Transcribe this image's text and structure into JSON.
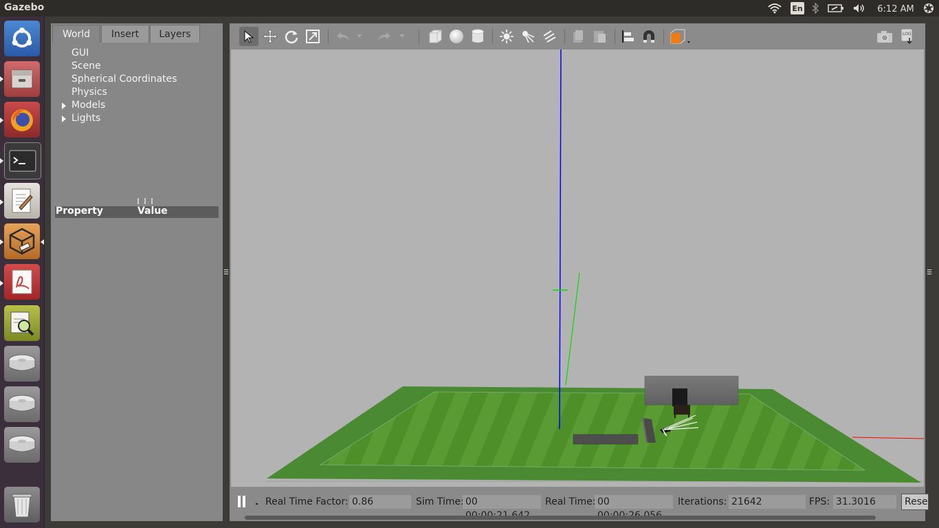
{
  "app": {
    "title": "Gazebo"
  },
  "topbar": {
    "language": "En",
    "clock": "6:12 AM"
  },
  "launcher": {
    "items": [
      {
        "name": "ubuntu-dash"
      },
      {
        "name": "files"
      },
      {
        "name": "firefox"
      },
      {
        "name": "terminal"
      },
      {
        "name": "text-editor"
      },
      {
        "name": "gazebo"
      },
      {
        "name": "document-viewer"
      },
      {
        "name": "system-monitor"
      },
      {
        "name": "drive-1"
      },
      {
        "name": "drive-2"
      },
      {
        "name": "drive-3"
      },
      {
        "name": "trash"
      }
    ]
  },
  "left_panel": {
    "tabs": [
      "World",
      "Insert",
      "Layers"
    ],
    "active_tab": "World",
    "tree": [
      {
        "label": "GUI",
        "expandable": false
      },
      {
        "label": "Scene",
        "expandable": false
      },
      {
        "label": "Spherical Coordinates",
        "expandable": false
      },
      {
        "label": "Physics",
        "expandable": false
      },
      {
        "label": "Models",
        "expandable": true
      },
      {
        "label": "Lights",
        "expandable": true
      }
    ],
    "property_header": {
      "property": "Property",
      "value": "Value"
    }
  },
  "toolbar": {
    "tools": [
      "select-mode",
      "translate-mode",
      "rotate-mode",
      "scale-mode",
      "undo",
      "undo-history",
      "redo",
      "redo-history",
      "box-shape",
      "sphere-shape",
      "cylinder-shape",
      "point-light",
      "spot-light",
      "directional-light",
      "copy",
      "paste",
      "align",
      "snap",
      "view-angle",
      "screenshot",
      "log-data"
    ]
  },
  "bottom_bar": {
    "real_time_factor_label": "Real Time Factor:",
    "real_time_factor": "0.86",
    "sim_time_label": "Sim Time:",
    "sim_time": "00 00:00:21.642",
    "real_time_label": "Real Time:",
    "real_time": "00 00:00:26.056",
    "iterations_label": "Iterations:",
    "iterations": "21642",
    "fps_label": "FPS:",
    "fps": "31.3016",
    "reset_label": "Reset"
  },
  "colors": {
    "ground_green": "#4f8f2a",
    "ground_border": "#4a8a32",
    "z_axis": "#0000ff",
    "y_axis": "#00e000",
    "x_axis": "#ff0000",
    "sky": "#b3b3b3",
    "wall": "#6c6c6c",
    "selection_orange": "#f07a14"
  }
}
